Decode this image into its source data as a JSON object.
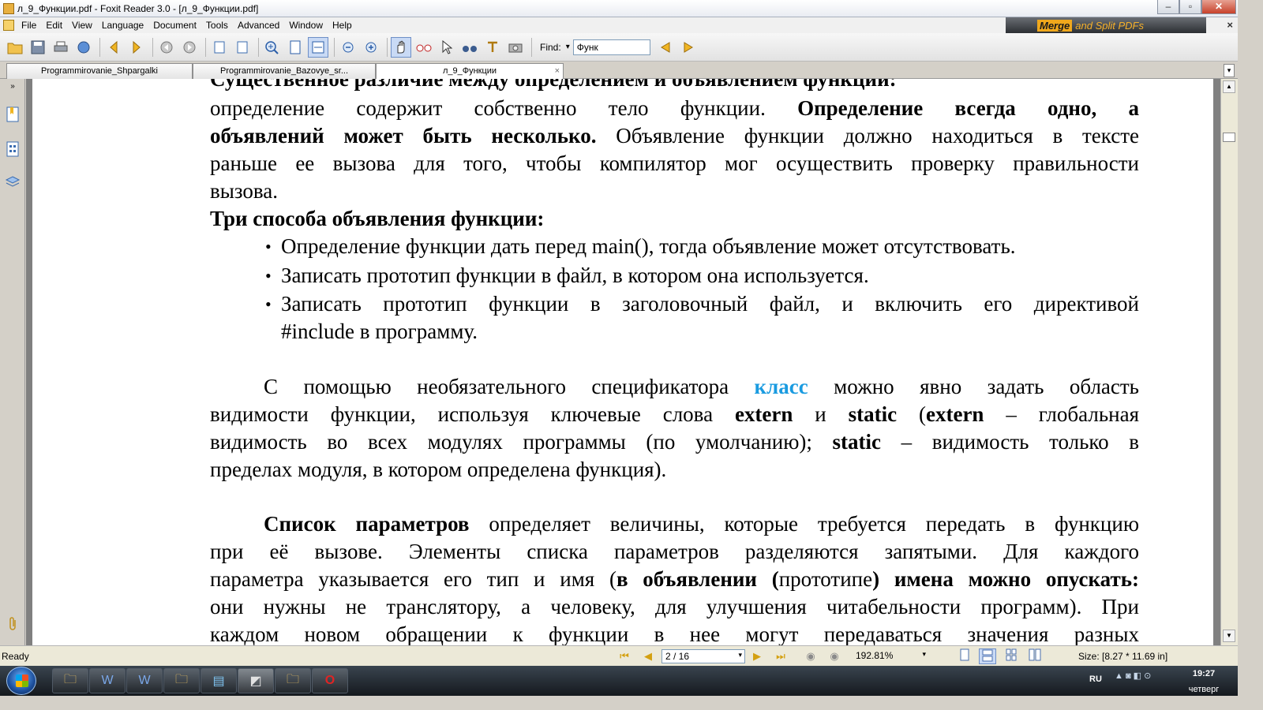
{
  "window": {
    "title": "л_9_Функции.pdf - Foxit Reader 3.0 - [л_9_Функции.pdf]",
    "controls": {
      "minimize": "–",
      "restore": "▫",
      "close": "✕"
    }
  },
  "menu": {
    "items": [
      "File",
      "Edit",
      "View",
      "Language",
      "Document",
      "Tools",
      "Advanced",
      "Window",
      "Help"
    ],
    "close_glyph": "×"
  },
  "banner": {
    "highlight": "Merge",
    "rest": "and Split PDFs"
  },
  "toolbar": {
    "find_label": "Find:",
    "find_value": "Функ",
    "find_dropdown": "▾"
  },
  "tabs": [
    {
      "label": "Programmirovanie_Shpargalki"
    },
    {
      "label": "Programmirovanie_Bazovye_sr..."
    },
    {
      "label": "л_9_Функции",
      "close": "×"
    }
  ],
  "tab_scroll": "▾",
  "side_panel": {
    "collapse": "»"
  },
  "document": {
    "cut_line": "Существенное различие между определением и объявлением функции:",
    "p1": {
      "l1": "определение содержит собственно тело функции. ",
      "l1b": "Определение всегда одно, а",
      "l2b": "объявлений может быть несколько.",
      "l2": " Объявление функции должно находиться в тексте",
      "l3": "раньше ее вызова для того, чтобы компилятор мог осуществить проверку правильности",
      "l4": "вызова."
    },
    "heading": "Три способа объявления функции:",
    "bullet_glyph": "•",
    "bullets": {
      "b1": "Определение функции дать перед main(), тогда объявление может отсутствовать.",
      "b2": "Записать прототип функции в файл, в котором она используется.",
      "b3l1": "Записать прототип функции в заголовочный файл, и включить его директивой",
      "b3l2": "#include в программу."
    },
    "p2": {
      "l1a": "С помощью необязательного спецификатора ",
      "l1kw": "класс",
      "l1b": " можно явно задать область",
      "l2a": "видимости функции, используя ключевые слова ",
      "l2k1": "extern",
      "l2m": " и ",
      "l2k2": "static",
      "l2n": " (",
      "l2k3": "extern",
      "l2c": " – глобальная",
      "l3a": "видимость во всех модулях программы (по умолчанию); ",
      "l3k": "static",
      "l3b": " – видимость только в",
      "l4": "пределах модуля, в котором определена функция)."
    },
    "p3": {
      "l1b": "Список параметров",
      "l1": " определяет величины, которые требуется передать в функцию",
      "l2": "при её вызове. Элементы списка параметров разделяются запятыми. Для каждого",
      "l3a": "параметра указывается его тип и имя (",
      "l3b1": "в объявлении (",
      "l3m": "прототипе",
      "l3b2": ") имена можно опускать:",
      "l4": "они нужны не транслятору, а человеку, для улучшения читабельности программ). При",
      "l5": "каждом новом обращении к функции в нее могут передаваться значения разных"
    }
  },
  "scrollbar": {
    "up": "▲",
    "down": "▼"
  },
  "status": {
    "ready": "Ready",
    "page": "2 / 16",
    "page_dropdown": "▾",
    "zoom": "192.81%",
    "zoom_dropdown": "▾",
    "size": "Size: [8.27 * 11.69 in]",
    "nav": {
      "first": "⏮",
      "prev": "◀",
      "next": "▶",
      "last": "⏭",
      "back": "◉",
      "forward": "◉"
    }
  },
  "taskbar": {
    "lang": "RU",
    "tray": "▲ ◙ ◧ ⊙",
    "time": "19:27",
    "day": "четверг",
    "apps": [
      "🗀",
      "W",
      "W",
      "🗀",
      "▤",
      "◩",
      "🗀",
      "O"
    ]
  },
  "colors": {
    "keyword": "#1a9be0",
    "page": "#ffffff",
    "doc_bg": "#808080"
  }
}
